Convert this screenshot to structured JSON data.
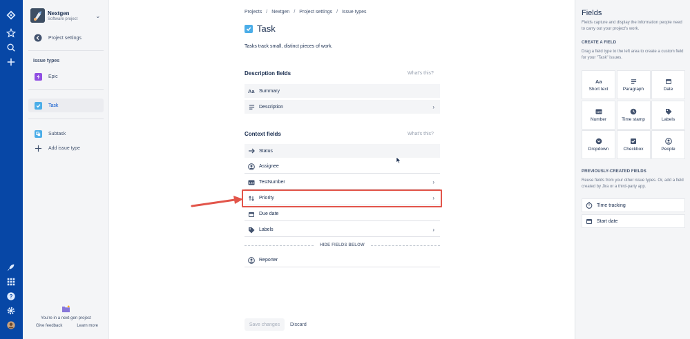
{
  "project": {
    "name": "Nextgen",
    "type": "Software project"
  },
  "sidebar": {
    "settings_label": "Project settings",
    "heading": "Issue types",
    "items": [
      {
        "label": "Epic",
        "color": "#904ee2"
      },
      {
        "label": "Task",
        "color": "#4bade8"
      },
      {
        "label": "Subtask",
        "color": "#4bade8"
      }
    ],
    "add_label": "Add issue type",
    "footer_text": "You're in a next-gen project",
    "give_feedback": "Give feedback",
    "learn_more": "Learn more"
  },
  "breadcrumbs": [
    "Projects",
    "Nextgen",
    "Project settings",
    "Issue types"
  ],
  "issue_type": {
    "title": "Task",
    "description": "Tasks track small, distinct pieces of work."
  },
  "description_fields": {
    "title": "Description fields",
    "whats_this": "What's this?",
    "items": [
      {
        "label": "Summary",
        "icon": "text-icon"
      },
      {
        "label": "Description",
        "icon": "lines-icon"
      }
    ]
  },
  "context_fields": {
    "title": "Context fields",
    "whats_this": "What's this?",
    "items": [
      {
        "label": "Status",
        "icon": "arrow-icon"
      },
      {
        "label": "Assignee",
        "icon": "person-icon"
      },
      {
        "label": "TestNumber",
        "icon": "number-icon"
      },
      {
        "label": "Priority",
        "icon": "priority-icon"
      },
      {
        "label": "Due date",
        "icon": "calendar-icon"
      },
      {
        "label": "Labels",
        "icon": "tag-icon"
      }
    ],
    "hide_label": "HIDE FIELDS BELOW",
    "hidden_items": [
      {
        "label": "Reporter",
        "icon": "person-icon"
      }
    ]
  },
  "actions": {
    "save": "Save changes",
    "discard": "Discard"
  },
  "panel": {
    "title": "Fields",
    "intro": "Fields capture and display the information people need to carry out your project's work.",
    "create_heading": "CREATE A FIELD",
    "create_text": "Drag a field type to the left area to create a custom field for your \"Task\" issues.",
    "field_types": [
      "Short text",
      "Paragraph",
      "Date",
      "Number",
      "Time stamp",
      "Labels",
      "Dropdown",
      "Checkbox",
      "People"
    ],
    "prev_heading": "PREVIOUSLY-CREATED FIELDS",
    "prev_text": "Reuse fields from your other issue types. Or, add a field created by Jira or a third-party app.",
    "prev_fields": [
      "Time tracking",
      "Start date"
    ]
  },
  "colors": {
    "nav": "#0747a6",
    "highlight": "#e2554a",
    "accent": "#0052cc"
  }
}
